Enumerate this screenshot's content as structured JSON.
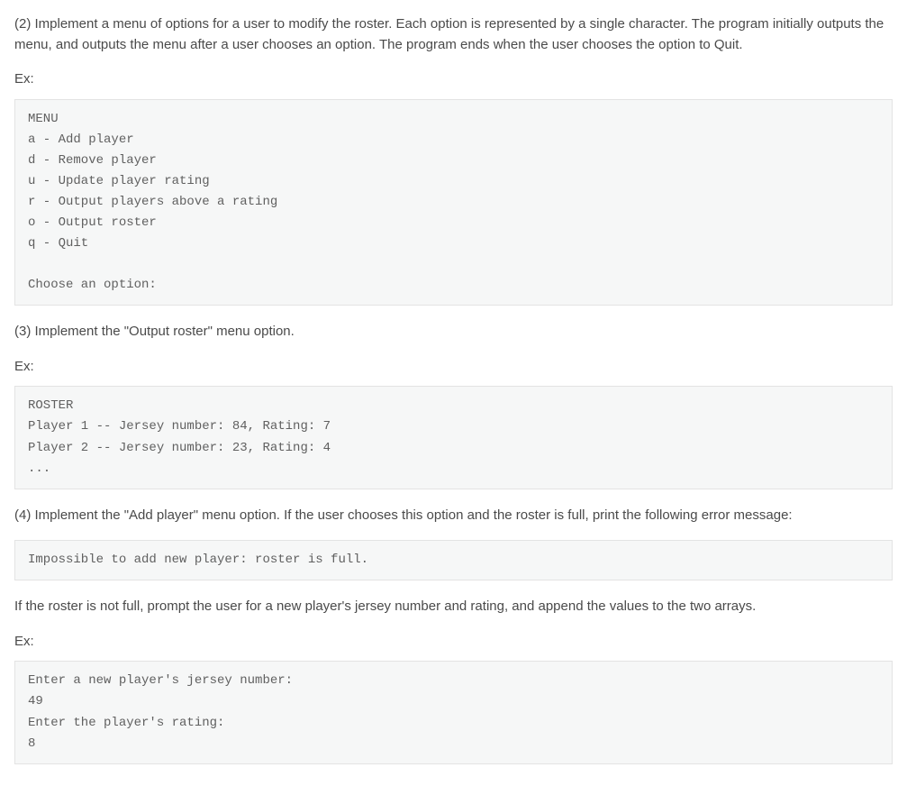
{
  "section2": {
    "instruction": "(2) Implement a menu of options for a user to modify the roster. Each option is represented by a single character. The program initially outputs the menu, and outputs the menu after a user chooses an option. The program ends when the user chooses the option to Quit.",
    "ex_label": "Ex:",
    "code": "MENU\na - Add player\nd - Remove player\nu - Update player rating\nr - Output players above a rating\no - Output roster\nq - Quit\n\nChoose an option:"
  },
  "section3": {
    "instruction": "(3) Implement the \"Output roster\" menu option.",
    "ex_label": "Ex:",
    "code": "ROSTER\nPlayer 1 -- Jersey number: 84, Rating: 7\nPlayer 2 -- Jersey number: 23, Rating: 4\n..."
  },
  "section4": {
    "instruction": "(4) Implement the \"Add player\" menu option. If the user chooses this option and the roster is full, print the following error message:",
    "code_error": "Impossible to add new player: roster is full.",
    "instruction2": "If the roster is not full, prompt the user for a new player's jersey number and rating, and append the values to the two arrays.",
    "ex_label": "Ex:",
    "code_prompt": "Enter a new player's jersey number:\n49\nEnter the player's rating:\n8"
  }
}
